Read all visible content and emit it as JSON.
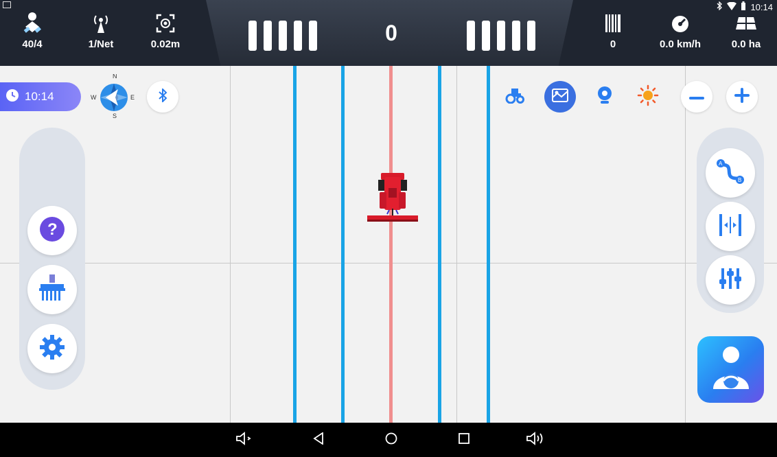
{
  "status_bar": {
    "time": "10:14",
    "icons": [
      "bluetooth-icon",
      "wifi-icon",
      "battery-icon"
    ]
  },
  "top": {
    "satellites": "40/4",
    "network": "1/Net",
    "accuracy": "0.02m",
    "offset": "0",
    "line_count": "0",
    "speed": "0.0 km/h",
    "area": "0.0 ha"
  },
  "map": {
    "clock": "10:14",
    "compass": {
      "n": "N",
      "e": "E",
      "s": "S",
      "w": "W"
    }
  },
  "left_panel": [
    "help-icon",
    "implement-icon",
    "settings-icon"
  ],
  "right_panel": [
    "ab-line-icon",
    "line-shift-icon",
    "adjust-icon"
  ],
  "nav": [
    "volume-down-icon",
    "back-icon",
    "home-icon",
    "recent-apps-icon",
    "volume-up-icon"
  ],
  "colors": {
    "topbar": "#1f2530",
    "guide": "#19a4e6",
    "center_line": "#f08f8f",
    "accent": "#2a7ef0"
  }
}
